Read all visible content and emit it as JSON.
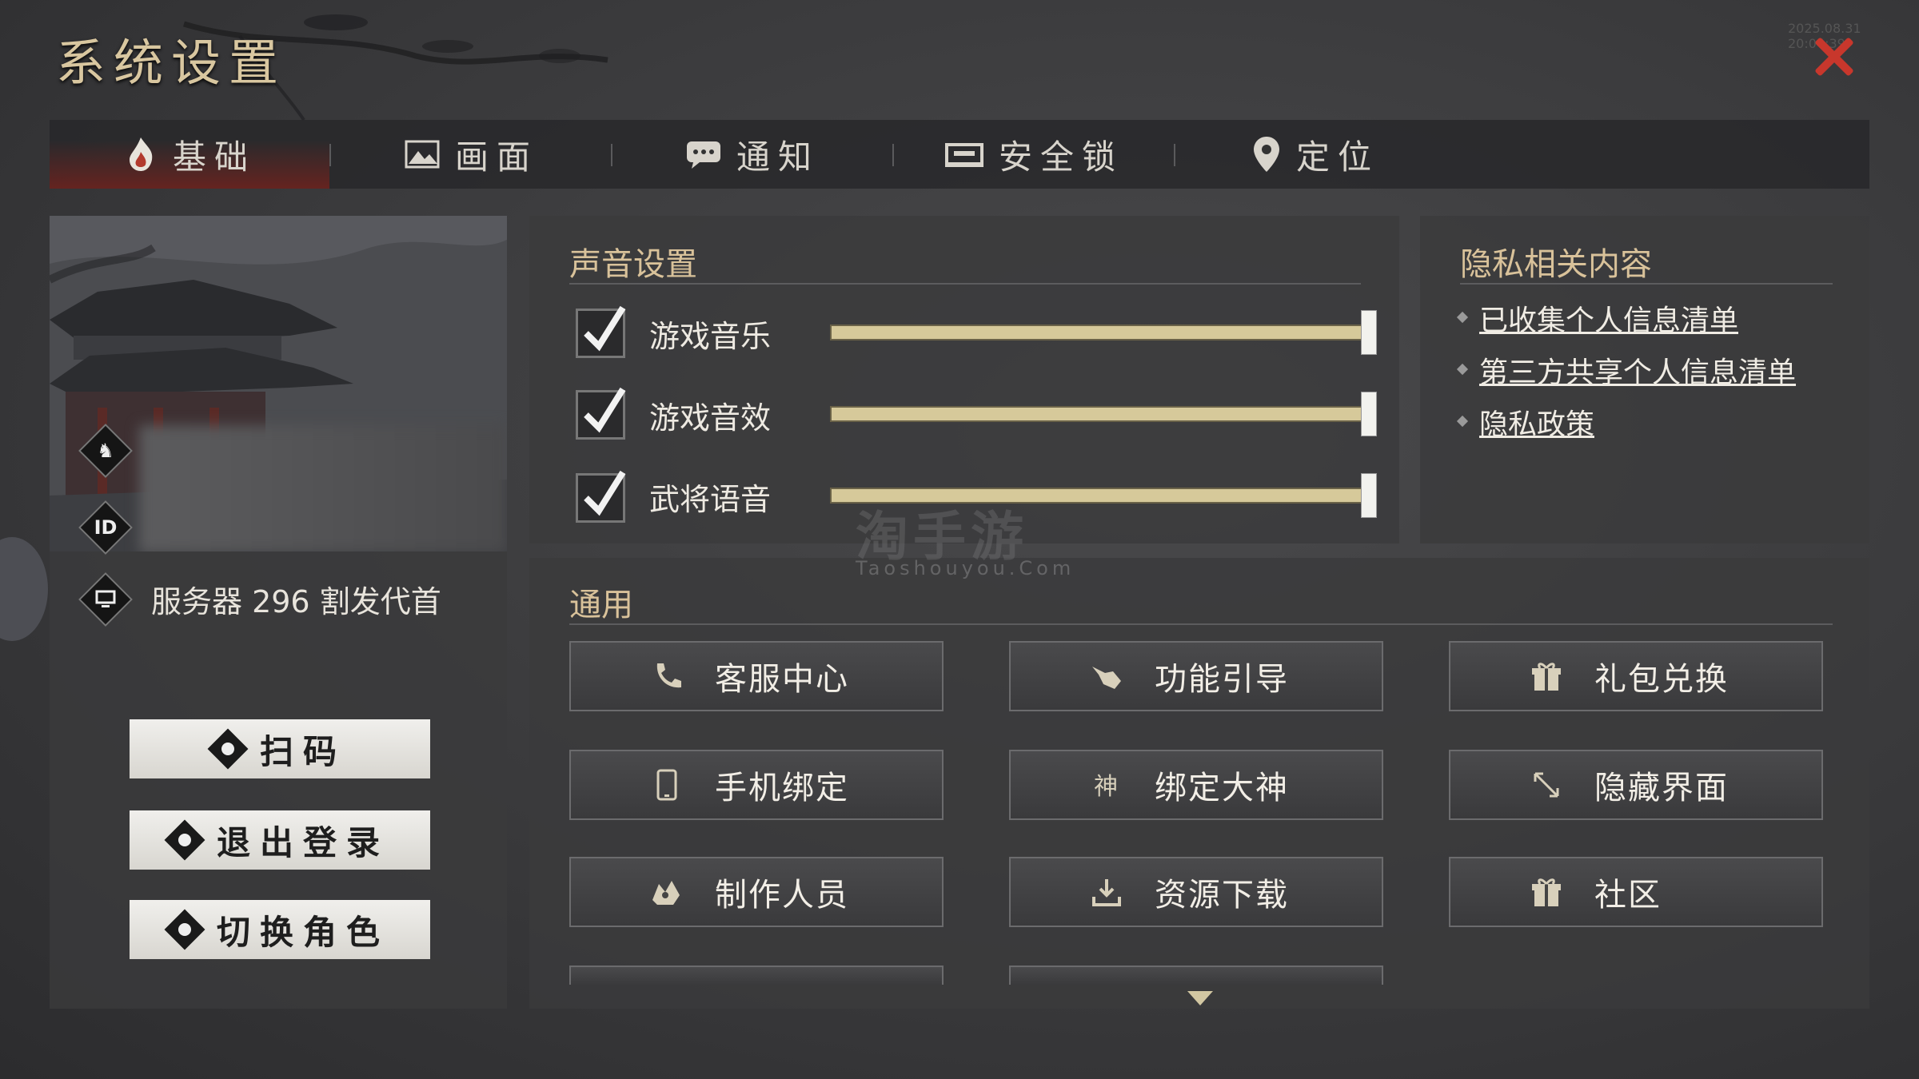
{
  "window": {
    "title": "系统设置",
    "timestamp": "2025.08.31 20:04:39"
  },
  "tabs": [
    {
      "label": "基础",
      "icon": "fire-icon",
      "active": true
    },
    {
      "label": "画面",
      "icon": "picture-icon",
      "active": false
    },
    {
      "label": "通知",
      "icon": "chat-icon",
      "active": false
    },
    {
      "label": "安全锁",
      "icon": "lock-icon",
      "active": false
    },
    {
      "label": "定位",
      "icon": "location-pin-icon",
      "active": false
    }
  ],
  "profile": {
    "id_badge": "ID",
    "server": "服务器 296 割发代首",
    "buttons": [
      {
        "label": "扫码",
        "icon": "scan-icon"
      },
      {
        "label": "退出登录",
        "icon": "logout-icon"
      },
      {
        "label": "切换角色",
        "icon": "switch-role-icon"
      }
    ]
  },
  "sound": {
    "title": "声音设置",
    "items": [
      {
        "label": "游戏音乐",
        "checked": true,
        "level": 1.0
      },
      {
        "label": "游戏音效",
        "checked": true,
        "level": 1.0
      },
      {
        "label": "武将语音",
        "checked": true,
        "level": 1.0
      }
    ]
  },
  "privacy": {
    "title": "隐私相关内容",
    "links": [
      "已收集个人信息清单",
      "第三方共享个人信息清单",
      "隐私政策"
    ]
  },
  "general": {
    "title": "通用",
    "buttons": [
      {
        "label": "客服中心",
        "icon": "phone-icon"
      },
      {
        "label": "功能引导",
        "icon": "pointer-hand-icon"
      },
      {
        "label": "礼包兑换",
        "icon": "gift-icon"
      },
      {
        "label": "手机绑定",
        "icon": "mobile-icon"
      },
      {
        "label": "绑定大神",
        "icon": "shen-glyph-icon"
      },
      {
        "label": "隐藏界面",
        "icon": "collapse-arrows-icon"
      },
      {
        "label": "制作人员",
        "icon": "crew-icon"
      },
      {
        "label": "资源下载",
        "icon": "download-icon"
      },
      {
        "label": "社区",
        "icon": "gift-icon"
      }
    ]
  },
  "watermark": {
    "cn": "淘手游",
    "en": "Taoshouyou.Com"
  },
  "colors": {
    "accent_gold": "#d9c29a",
    "close_red": "#c8372c",
    "slider": "#d1c28f"
  }
}
